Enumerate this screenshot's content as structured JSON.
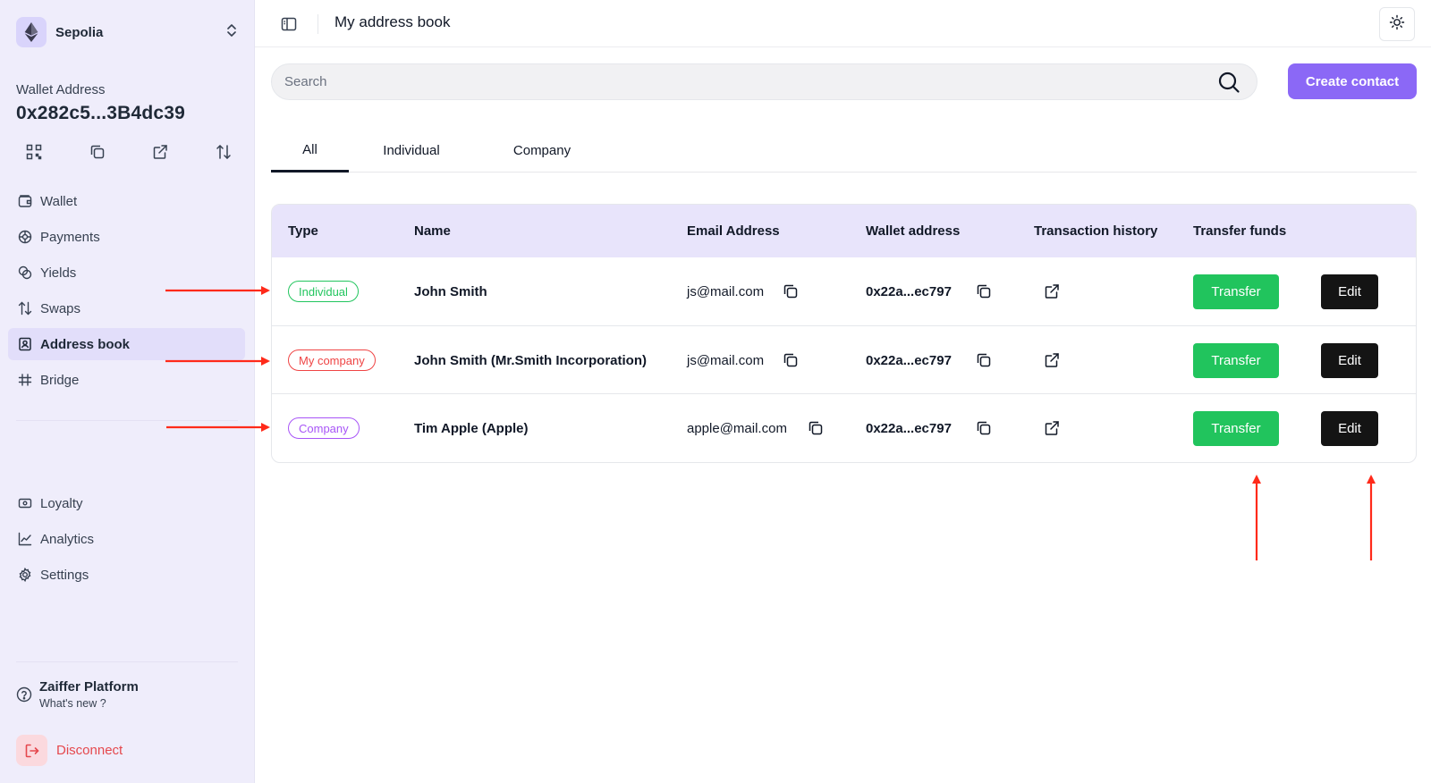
{
  "network": {
    "name": "Sepolia",
    "icon": "ethereum-icon"
  },
  "wallet": {
    "label": "Wallet Address",
    "address": "0x282c5...3B4dc39",
    "actions": [
      "qr-code-icon",
      "copy-icon",
      "external-link-icon",
      "swap-arrows-icon"
    ]
  },
  "nav": {
    "items": [
      {
        "label": "Wallet",
        "icon": "wallet-icon"
      },
      {
        "label": "Payments",
        "icon": "payments-icon"
      },
      {
        "label": "Yields",
        "icon": "yields-icon"
      },
      {
        "label": "Swaps",
        "icon": "swap-icon"
      },
      {
        "label": "Address book",
        "icon": "address-book-icon",
        "active": true
      },
      {
        "label": "Bridge",
        "icon": "bridge-icon"
      }
    ],
    "secondary": [
      {
        "label": "Loyalty",
        "icon": "loyalty-icon"
      },
      {
        "label": "Analytics",
        "icon": "analytics-icon"
      },
      {
        "label": "Settings",
        "icon": "settings-icon"
      }
    ]
  },
  "platform": {
    "title": "Zaiffer Platform",
    "subtitle": "What's new ?"
  },
  "disconnect": {
    "label": "Disconnect"
  },
  "header": {
    "title": "My address book"
  },
  "search": {
    "placeholder": "Search",
    "value": ""
  },
  "create_contact": {
    "label": "Create contact"
  },
  "tabs": [
    {
      "label": "All",
      "active": true
    },
    {
      "label": "Individual"
    },
    {
      "label": "Company"
    }
  ],
  "table": {
    "headers": [
      "Type",
      "Name",
      "Email Address",
      "Wallet address",
      "Transaction history",
      "Transfer funds"
    ],
    "rows": [
      {
        "type": "Individual",
        "type_color": "#22c55e",
        "name": "John Smith",
        "email": "js@mail.com",
        "wallet": "0x22a...ec797",
        "transfer": "Transfer",
        "edit": "Edit"
      },
      {
        "type": "My company",
        "type_color": "#ef4444",
        "name": "John Smith (Mr.Smith Incorporation)",
        "email": "js@mail.com",
        "wallet": "0x22a...ec797",
        "transfer": "Transfer",
        "edit": "Edit"
      },
      {
        "type": "Company",
        "type_color": "#a855f7",
        "name": "Tim Apple (Apple)",
        "email": "apple@mail.com",
        "wallet": "0x22a...ec797",
        "transfer": "Transfer",
        "edit": "Edit"
      }
    ]
  },
  "colors": {
    "sidebar_bg": "#efedfb",
    "accent": "#8b68f6",
    "table_header_bg": "#e8e4fb",
    "transfer": "#21c45d",
    "edit": "#141414",
    "danger": "#e5484d",
    "annotation_arrow": "#ff2a1a"
  }
}
